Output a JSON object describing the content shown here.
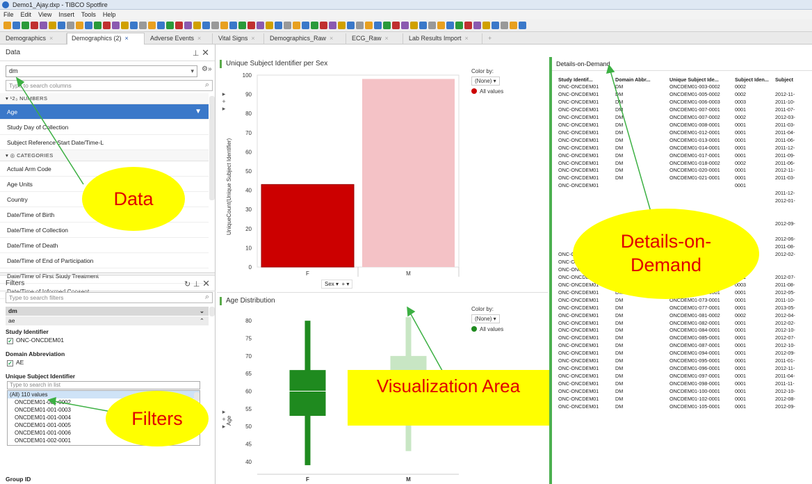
{
  "window": {
    "title": "Demo1_Ajay.dxp - TIBCO Spotfire"
  },
  "menu": [
    "File",
    "Edit",
    "View",
    "Insert",
    "Tools",
    "Help"
  ],
  "tabs": [
    {
      "label": "Demographics"
    },
    {
      "label": "Demographics (2)"
    },
    {
      "label": "Adverse Events"
    },
    {
      "label": "Vital Signs"
    },
    {
      "label": "Demographics_Raw"
    },
    {
      "label": "ECG_Raw"
    },
    {
      "label": "Lab Results Import"
    }
  ],
  "data_panel": {
    "title": "Data",
    "table": "dm",
    "search_placeholder": "Type to search columns",
    "numbers_label": "¹2₃ NUMBERS",
    "numbers": [
      "Age",
      "Study Day of Collection",
      "Subject Reference Start Date/Time-L"
    ],
    "categories_label": "CATEGORIES",
    "categories": [
      "Actual Arm Code",
      "Age Units",
      "Country",
      "Date/Time of Birth",
      "Date/Time of Collection",
      "Date/Time of Death",
      "Date/Time of End of Participation",
      "Date/Time of First Study Treatment",
      "Date/Time of Informed Consent"
    ]
  },
  "filters_panel": {
    "title": "Filters",
    "search_placeholder": "Type to search filters",
    "tables": [
      "dm",
      "ae"
    ],
    "study_identifier": {
      "label": "Study Identifier",
      "value": "ONC-ONCDEM01"
    },
    "domain_abbreviation": {
      "label": "Domain Abbreviation",
      "value": "AE"
    },
    "unique_subject": {
      "label": "Unique Subject Identifier",
      "search_placeholder": "Type to search in list",
      "items": [
        "(All) 110 values",
        "ONCDEM01-001-0002",
        "ONCDEM01-001-0003",
        "ONCDEM01-001-0004",
        "ONCDEM01-001-0005",
        "ONCDEM01-001-0006",
        "ONCDEM01-002-0001"
      ]
    },
    "group_id": "Group ID"
  },
  "bar_chart": {
    "title": "Unique Subject Identifier per Sex",
    "ylabel": "UniqueCount(Unique Subject Identifier)",
    "xaxis": "Sex",
    "yticks": [
      0,
      10,
      20,
      30,
      40,
      50,
      60,
      70,
      80,
      90,
      100
    ],
    "colorby_label": "Color by:",
    "colorby_value": "(None)",
    "legend": "All values"
  },
  "box_chart": {
    "title": "Age Distribution",
    "ylabel": "Age",
    "yticks": [
      40,
      45,
      50,
      55,
      60,
      65,
      70,
      75,
      80
    ],
    "colorby_label": "Color by:",
    "colorby_value": "(None)",
    "legend": "All values",
    "categories": [
      "F",
      "M"
    ]
  },
  "details": {
    "title": "Details-on-Demand",
    "columns": [
      "Study Identif...",
      "Domain Abbr...",
      "Unique Subject Ide...",
      "Subject Iden...",
      "Subject"
    ],
    "rows": [
      [
        "ONC-ONCDEM01",
        "DM",
        "ONCDEM01-003-0002",
        "0002",
        ""
      ],
      [
        "ONC-ONCDEM01",
        "DM",
        "ONCDEM01-005-0002",
        "0002",
        "2012-11-"
      ],
      [
        "ONC-ONCDEM01",
        "DM",
        "ONCDEM01-006-0003",
        "0003",
        "2011-10-"
      ],
      [
        "ONC-ONCDEM01",
        "DM",
        "ONCDEM01-007-0001",
        "0001",
        "2011-07-"
      ],
      [
        "ONC-ONCDEM01",
        "DM",
        "ONCDEM01-007-0002",
        "0002",
        "2012-03-"
      ],
      [
        "ONC-ONCDEM01",
        "DM",
        "ONCDEM01-008-0001",
        "0001",
        "2011-03-"
      ],
      [
        "ONC-ONCDEM01",
        "DM",
        "ONCDEM01-012-0001",
        "0001",
        "2011-04-"
      ],
      [
        "ONC-ONCDEM01",
        "DM",
        "ONCDEM01-013-0001",
        "0001",
        "2011-06-"
      ],
      [
        "ONC-ONCDEM01",
        "DM",
        "ONCDEM01-014-0001",
        "0001",
        "2011-12-"
      ],
      [
        "ONC-ONCDEM01",
        "DM",
        "ONCDEM01-017-0001",
        "0001",
        "2011-09-"
      ],
      [
        "ONC-ONCDEM01",
        "DM",
        "ONCDEM01-018-0002",
        "0002",
        "2011-06-"
      ],
      [
        "ONC-ONCDEM01",
        "DM",
        "ONCDEM01-020-0001",
        "0001",
        "2012-11-"
      ],
      [
        "ONC-ONCDEM01",
        "DM",
        "ONCDEM01-021-0001",
        "0001",
        "2011-03-"
      ],
      [
        "ONC-ONCDEM01",
        "",
        "",
        "0001",
        ""
      ],
      [
        "",
        "",
        "",
        "",
        "2011-12-"
      ],
      [
        "",
        "",
        "",
        "",
        "2012-01-"
      ],
      [
        "",
        "",
        "",
        "",
        ""
      ],
      [
        "",
        "",
        "",
        "",
        ""
      ],
      [
        "",
        "",
        "",
        "",
        "2012-09-"
      ],
      [
        "",
        "",
        "",
        "",
        ""
      ],
      [
        "",
        "",
        "",
        "",
        "2012-06-"
      ],
      [
        "",
        "",
        "",
        "",
        "2011-08-"
      ],
      [
        "ONC-ONCDEM01",
        "DM",
        "",
        "0001",
        "2012-02-"
      ],
      [
        "ONC-ONCDEM01",
        "DM",
        "ONCDEM01-044-0001",
        "0001",
        ""
      ],
      [
        "ONC-ONCDEM01",
        "DM",
        "ONCDEM01-049-0001",
        "0001",
        ""
      ],
      [
        "ONC-ONCDEM01",
        "DM",
        "ONCDEM01-053-0001",
        "0001",
        "2012-07-"
      ],
      [
        "ONC-ONCDEM01",
        "DM",
        "ONCDEM01-060-0003",
        "0003",
        "2011-08-"
      ],
      [
        "ONC-ONCDEM01",
        "DM",
        "ONCDEM01-069-0001",
        "0001",
        "2012-05-"
      ],
      [
        "ONC-ONCDEM01",
        "DM",
        "ONCDEM01-073-0001",
        "0001",
        "2011-10-"
      ],
      [
        "ONC-ONCDEM01",
        "DM",
        "ONCDEM01-077-0001",
        "0001",
        "2013-05-"
      ],
      [
        "ONC-ONCDEM01",
        "DM",
        "ONCDEM01-081-0002",
        "0002",
        "2012-04-"
      ],
      [
        "ONC-ONCDEM01",
        "DM",
        "ONCDEM01-082-0001",
        "0001",
        "2012-02-"
      ],
      [
        "ONC-ONCDEM01",
        "DM",
        "ONCDEM01-084-0001",
        "0001",
        "2012-10-"
      ],
      [
        "ONC-ONCDEM01",
        "DM",
        "ONCDEM01-085-0001",
        "0001",
        "2012-07-"
      ],
      [
        "ONC-ONCDEM01",
        "DM",
        "ONCDEM01-087-0001",
        "0001",
        "2012-10-"
      ],
      [
        "ONC-ONCDEM01",
        "DM",
        "ONCDEM01-094-0001",
        "0001",
        "2012-09-"
      ],
      [
        "ONC-ONCDEM01",
        "DM",
        "ONCDEM01-095-0001",
        "0001",
        "2011-01-"
      ],
      [
        "ONC-ONCDEM01",
        "DM",
        "ONCDEM01-096-0001",
        "0001",
        "2012-11-"
      ],
      [
        "ONC-ONCDEM01",
        "DM",
        "ONCDEM01-097-0001",
        "0001",
        "2011-04-"
      ],
      [
        "ONC-ONCDEM01",
        "DM",
        "ONCDEM01-098-0001",
        "0001",
        "2011-11-"
      ],
      [
        "ONC-ONCDEM01",
        "DM",
        "ONCDEM01-100-0001",
        "0001",
        "2012-10-"
      ],
      [
        "ONC-ONCDEM01",
        "DM",
        "ONCDEM01-102-0001",
        "0001",
        "2012-08-"
      ],
      [
        "ONC-ONCDEM01",
        "DM",
        "ONCDEM01-105-0001",
        "0001",
        "2012-09-"
      ]
    ]
  },
  "annotations": {
    "data": "Data",
    "filters": "Filters",
    "viz": "Visualization Area",
    "dod": "Details-on-Demand"
  },
  "chart_data": [
    {
      "type": "bar",
      "title": "Unique Subject Identifier per Sex",
      "categories": [
        "F",
        "M"
      ],
      "values": [
        43,
        98
      ],
      "colors": [
        "#cc0000",
        "#f4c2c6"
      ],
      "ylabel": "UniqueCount(Unique Subject Identifier)",
      "xlabel": "Sex",
      "ylim": [
        0,
        100
      ]
    },
    {
      "type": "box",
      "title": "Age Distribution",
      "categories": [
        "F",
        "M"
      ],
      "series": [
        {
          "name": "F",
          "min": 39,
          "q1": 53,
          "median": 60,
          "q3": 66,
          "max": 80
        },
        {
          "name": "M",
          "min": 43,
          "q1": 56,
          "median": 61,
          "q3": 70,
          "max": 81
        }
      ],
      "ylabel": "Age",
      "ylim": [
        38,
        83
      ]
    }
  ]
}
